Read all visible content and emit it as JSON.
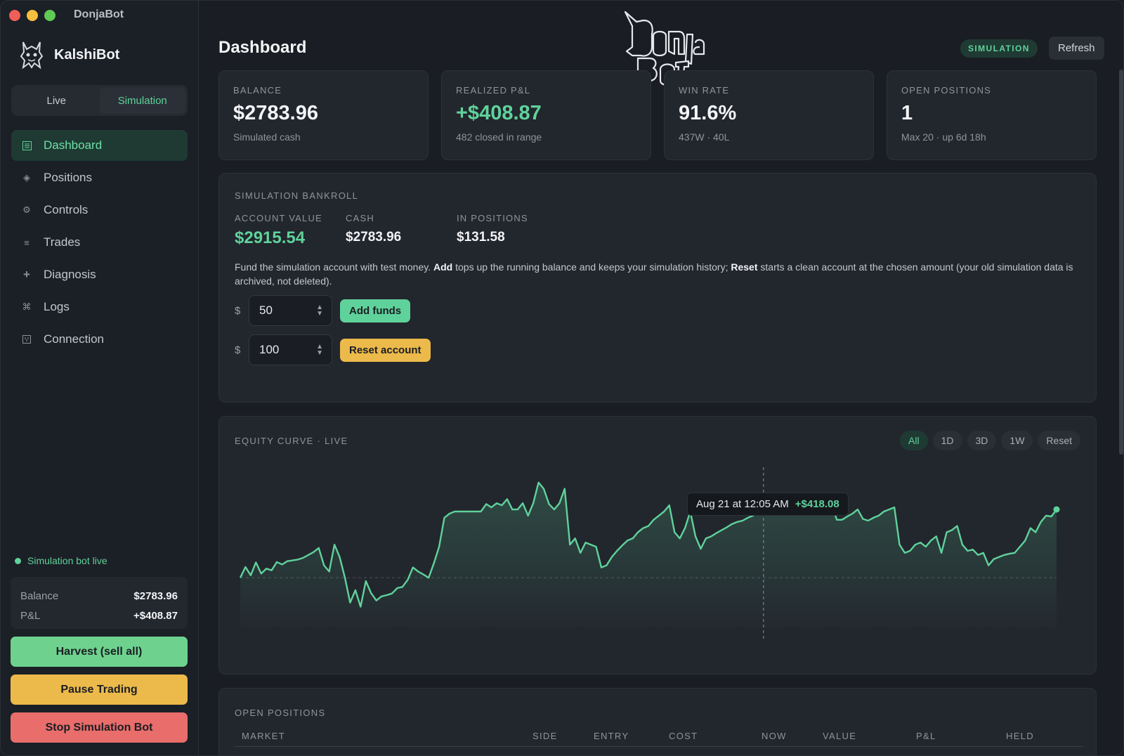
{
  "window": {
    "title": "DonjaBot"
  },
  "sidebar": {
    "brand": "KalshiBot",
    "modes": [
      "Live",
      "Simulation"
    ],
    "active_mode": "Simulation",
    "nav": [
      {
        "label": "Dashboard",
        "icon": "dashboard-icon",
        "active": true
      },
      {
        "label": "Positions",
        "icon": "diamond-icon"
      },
      {
        "label": "Controls",
        "icon": "gear-icon"
      },
      {
        "label": "Trades",
        "icon": "list-icon"
      },
      {
        "label": "Diagnosis",
        "icon": "plus-icon"
      },
      {
        "label": "Logs",
        "icon": "command-icon"
      },
      {
        "label": "Connection",
        "icon": "plug-icon"
      }
    ],
    "status": "Simulation bot live",
    "summary": {
      "balance_label": "Balance",
      "balance": "$2783.96",
      "pnl_label": "P&L",
      "pnl": "+$408.87"
    },
    "buttons": {
      "harvest": "Harvest (sell all)",
      "pause": "Pause Trading",
      "stop": "Stop Simulation Bot"
    }
  },
  "header": {
    "title": "Dashboard",
    "badge": "SIMULATION",
    "refresh": "Refresh",
    "logo_text": "DonjaBot"
  },
  "stats": [
    {
      "label": "BALANCE",
      "value": "$2783.96",
      "sub": "Simulated cash"
    },
    {
      "label": "REALIZED P&L",
      "value": "+$408.87",
      "sub": "482 closed in range"
    },
    {
      "label": "WIN RATE",
      "value": "91.6%",
      "sub": "437W · 40L"
    },
    {
      "label": "OPEN POSITIONS",
      "value": "1",
      "sub": "Max 20 · up 6d 18h"
    }
  ],
  "bankroll": {
    "title": "SIMULATION BANKROLL",
    "account_value_label": "ACCOUNT VALUE",
    "account_value": "$2915.54",
    "cash_label": "CASH",
    "cash": "$2783.96",
    "in_positions_label": "IN POSITIONS",
    "in_positions": "$131.58",
    "desc_1": "Fund the simulation account with test money. ",
    "desc_add": "Add",
    "desc_2": " tops up the running balance and keeps your simulation history; ",
    "desc_reset": "Reset",
    "desc_3": " starts a clean account at the chosen amount (your old simulation data is archived, not deleted).",
    "currency": "$",
    "add_amount": "50",
    "add_button": "Add funds",
    "reset_amount": "100",
    "reset_button": "Reset account"
  },
  "equity": {
    "title": "EQUITY CURVE · LIVE",
    "ranges": [
      "All",
      "1D",
      "3D",
      "1W",
      "Reset"
    ],
    "active_range": "All",
    "tooltip_date": "Aug 21 at 12:05 AM",
    "tooltip_value": "+$418.08",
    "tooltip_index": 100
  },
  "chart_data": {
    "type": "area",
    "title": "EQUITY CURVE · LIVE",
    "series": [
      {
        "values": [
          0,
          26,
          6,
          37,
          10,
          22,
          18,
          38,
          32,
          40,
          42,
          44,
          48,
          55,
          62,
          72,
          30,
          15,
          80,
          50,
          0,
          -60,
          -30,
          -70,
          -8,
          -37,
          -55,
          -45,
          -42,
          -38,
          -25,
          -22,
          -5,
          25,
          15,
          8,
          0,
          35,
          75,
          145,
          155,
          160,
          160,
          160,
          160,
          160,
          160,
          178,
          170,
          180,
          175,
          190,
          165,
          165,
          180,
          150,
          180,
          230,
          215,
          178,
          165,
          180,
          215,
          80,
          95,
          60,
          85,
          80,
          75,
          25,
          30,
          50,
          65,
          78,
          90,
          95,
          110,
          120,
          125,
          140,
          150,
          160,
          175,
          110,
          95,
          120,
          160,
          100,
          70,
          95,
          100,
          108,
          115,
          122,
          130,
          135,
          138,
          145,
          150,
          158,
          165,
          170,
          172,
          175,
          178,
          180,
          160,
          170,
          165,
          178,
          158,
          175,
          168,
          178,
          140,
          140,
          148,
          155,
          165,
          142,
          138,
          145,
          150,
          160,
          165,
          170,
          80,
          60,
          65,
          80,
          85,
          75,
          90,
          100,
          60,
          110,
          115,
          125,
          80,
          65,
          68,
          55,
          60,
          30,
          45,
          50,
          55,
          58,
          60,
          75,
          90,
          120,
          110,
          135,
          150,
          148,
          165
        ]
      }
    ],
    "baseline": 0,
    "ylim": [
      -120,
      250
    ]
  },
  "open_positions": {
    "title": "OPEN POSITIONS",
    "columns": [
      "MARKET",
      "SIDE",
      "ENTRY",
      "COST",
      "NOW",
      "VALUE",
      "P&L",
      "HELD"
    ]
  },
  "colors": {
    "accent": "#5fd29b",
    "warning": "#ecba4a",
    "danger": "#e86d6b",
    "background": "#1a1d23",
    "card": "#22262d"
  }
}
